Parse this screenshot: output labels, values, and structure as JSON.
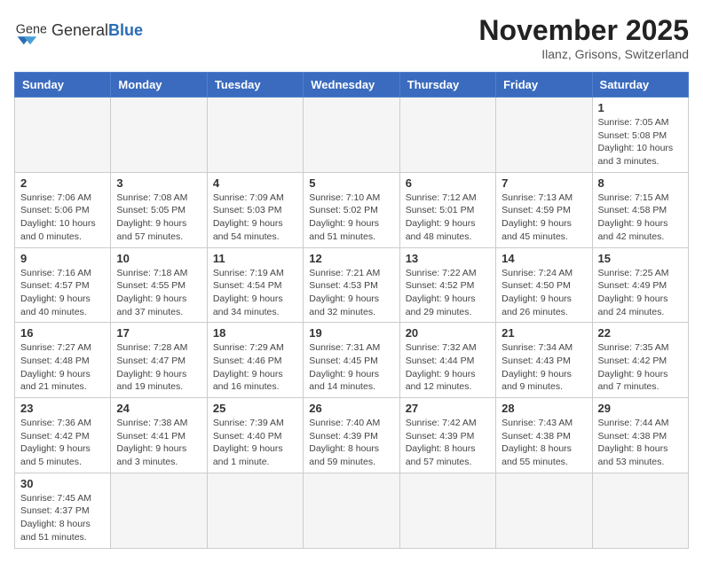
{
  "header": {
    "logo_text_normal": "General",
    "logo_text_bold": "Blue",
    "month_title": "November 2025",
    "location": "Ilanz, Grisons, Switzerland"
  },
  "weekdays": [
    "Sunday",
    "Monday",
    "Tuesday",
    "Wednesday",
    "Thursday",
    "Friday",
    "Saturday"
  ],
  "weeks": [
    [
      {
        "day": "",
        "info": ""
      },
      {
        "day": "",
        "info": ""
      },
      {
        "day": "",
        "info": ""
      },
      {
        "day": "",
        "info": ""
      },
      {
        "day": "",
        "info": ""
      },
      {
        "day": "",
        "info": ""
      },
      {
        "day": "1",
        "info": "Sunrise: 7:05 AM\nSunset: 5:08 PM\nDaylight: 10 hours\nand 3 minutes."
      }
    ],
    [
      {
        "day": "2",
        "info": "Sunrise: 7:06 AM\nSunset: 5:06 PM\nDaylight: 10 hours\nand 0 minutes."
      },
      {
        "day": "3",
        "info": "Sunrise: 7:08 AM\nSunset: 5:05 PM\nDaylight: 9 hours\nand 57 minutes."
      },
      {
        "day": "4",
        "info": "Sunrise: 7:09 AM\nSunset: 5:03 PM\nDaylight: 9 hours\nand 54 minutes."
      },
      {
        "day": "5",
        "info": "Sunrise: 7:10 AM\nSunset: 5:02 PM\nDaylight: 9 hours\nand 51 minutes."
      },
      {
        "day": "6",
        "info": "Sunrise: 7:12 AM\nSunset: 5:01 PM\nDaylight: 9 hours\nand 48 minutes."
      },
      {
        "day": "7",
        "info": "Sunrise: 7:13 AM\nSunset: 4:59 PM\nDaylight: 9 hours\nand 45 minutes."
      },
      {
        "day": "8",
        "info": "Sunrise: 7:15 AM\nSunset: 4:58 PM\nDaylight: 9 hours\nand 42 minutes."
      }
    ],
    [
      {
        "day": "9",
        "info": "Sunrise: 7:16 AM\nSunset: 4:57 PM\nDaylight: 9 hours\nand 40 minutes."
      },
      {
        "day": "10",
        "info": "Sunrise: 7:18 AM\nSunset: 4:55 PM\nDaylight: 9 hours\nand 37 minutes."
      },
      {
        "day": "11",
        "info": "Sunrise: 7:19 AM\nSunset: 4:54 PM\nDaylight: 9 hours\nand 34 minutes."
      },
      {
        "day": "12",
        "info": "Sunrise: 7:21 AM\nSunset: 4:53 PM\nDaylight: 9 hours\nand 32 minutes."
      },
      {
        "day": "13",
        "info": "Sunrise: 7:22 AM\nSunset: 4:52 PM\nDaylight: 9 hours\nand 29 minutes."
      },
      {
        "day": "14",
        "info": "Sunrise: 7:24 AM\nSunset: 4:50 PM\nDaylight: 9 hours\nand 26 minutes."
      },
      {
        "day": "15",
        "info": "Sunrise: 7:25 AM\nSunset: 4:49 PM\nDaylight: 9 hours\nand 24 minutes."
      }
    ],
    [
      {
        "day": "16",
        "info": "Sunrise: 7:27 AM\nSunset: 4:48 PM\nDaylight: 9 hours\nand 21 minutes."
      },
      {
        "day": "17",
        "info": "Sunrise: 7:28 AM\nSunset: 4:47 PM\nDaylight: 9 hours\nand 19 minutes."
      },
      {
        "day": "18",
        "info": "Sunrise: 7:29 AM\nSunset: 4:46 PM\nDaylight: 9 hours\nand 16 minutes."
      },
      {
        "day": "19",
        "info": "Sunrise: 7:31 AM\nSunset: 4:45 PM\nDaylight: 9 hours\nand 14 minutes."
      },
      {
        "day": "20",
        "info": "Sunrise: 7:32 AM\nSunset: 4:44 PM\nDaylight: 9 hours\nand 12 minutes."
      },
      {
        "day": "21",
        "info": "Sunrise: 7:34 AM\nSunset: 4:43 PM\nDaylight: 9 hours\nand 9 minutes."
      },
      {
        "day": "22",
        "info": "Sunrise: 7:35 AM\nSunset: 4:42 PM\nDaylight: 9 hours\nand 7 minutes."
      }
    ],
    [
      {
        "day": "23",
        "info": "Sunrise: 7:36 AM\nSunset: 4:42 PM\nDaylight: 9 hours\nand 5 minutes."
      },
      {
        "day": "24",
        "info": "Sunrise: 7:38 AM\nSunset: 4:41 PM\nDaylight: 9 hours\nand 3 minutes."
      },
      {
        "day": "25",
        "info": "Sunrise: 7:39 AM\nSunset: 4:40 PM\nDaylight: 9 hours\nand 1 minute."
      },
      {
        "day": "26",
        "info": "Sunrise: 7:40 AM\nSunset: 4:39 PM\nDaylight: 8 hours\nand 59 minutes."
      },
      {
        "day": "27",
        "info": "Sunrise: 7:42 AM\nSunset: 4:39 PM\nDaylight: 8 hours\nand 57 minutes."
      },
      {
        "day": "28",
        "info": "Sunrise: 7:43 AM\nSunset: 4:38 PM\nDaylight: 8 hours\nand 55 minutes."
      },
      {
        "day": "29",
        "info": "Sunrise: 7:44 AM\nSunset: 4:38 PM\nDaylight: 8 hours\nand 53 minutes."
      }
    ],
    [
      {
        "day": "30",
        "info": "Sunrise: 7:45 AM\nSunset: 4:37 PM\nDaylight: 8 hours\nand 51 minutes."
      },
      {
        "day": "",
        "info": ""
      },
      {
        "day": "",
        "info": ""
      },
      {
        "day": "",
        "info": ""
      },
      {
        "day": "",
        "info": ""
      },
      {
        "day": "",
        "info": ""
      },
      {
        "day": "",
        "info": ""
      }
    ]
  ]
}
